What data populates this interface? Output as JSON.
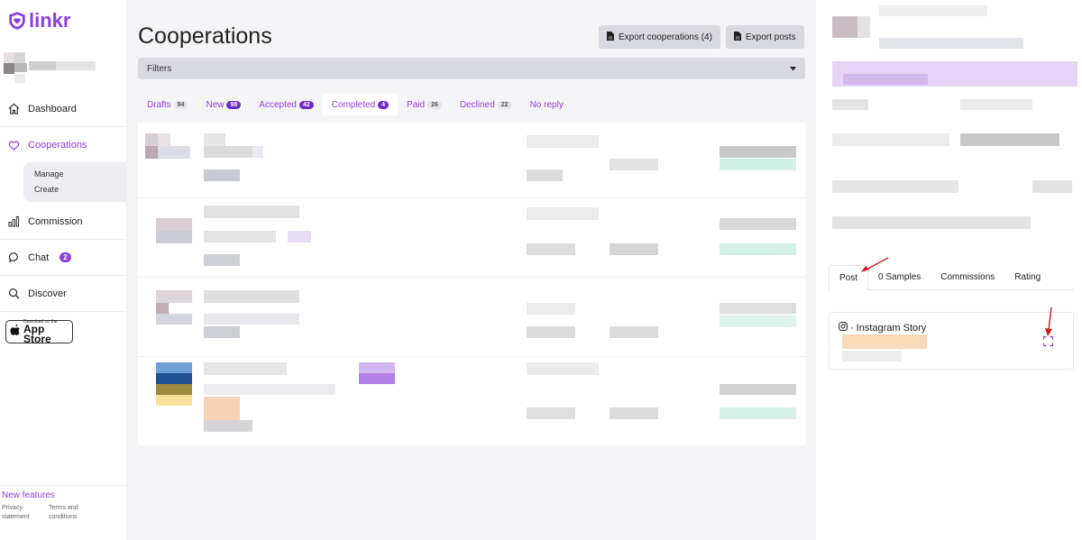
{
  "brand": {
    "name": "linkr",
    "color": "#8b3fe0"
  },
  "sidebar": {
    "items": [
      {
        "label": "Dashboard",
        "icon": "home-icon"
      },
      {
        "label": "Cooperations",
        "icon": "heart-icon"
      },
      {
        "label": "Commission",
        "icon": "bar-chart-icon"
      },
      {
        "label": "Chat",
        "icon": "chat-icon",
        "badge": "2"
      },
      {
        "label": "Discover",
        "icon": "search-icon"
      }
    ],
    "sub_items": [
      "Manage",
      "Create"
    ],
    "appstore": {
      "small": "Download on the",
      "big": "App Store"
    },
    "new_features": "New features",
    "footer": {
      "privacy": "Privacy statement",
      "terms": "Terms and conditions"
    }
  },
  "main": {
    "title": "Cooperations",
    "export_cooperations": "Export cooperations (4)",
    "export_posts": "Export posts",
    "filters": "Filters",
    "tabs": [
      {
        "label": "Drafts",
        "count": "94"
      },
      {
        "label": "New",
        "count": "98"
      },
      {
        "label": "Accepted",
        "count": "42"
      },
      {
        "label": "Completed",
        "count": "4"
      },
      {
        "label": "Paid",
        "count": "26"
      },
      {
        "label": "Declined",
        "count": "22"
      },
      {
        "label": "No reply",
        "count": ""
      }
    ]
  },
  "panel": {
    "tabs": [
      "Post",
      "0 Samples",
      "Commissions",
      "Rating"
    ],
    "post": {
      "platform": "Instagram Story",
      "separator": "·"
    }
  }
}
